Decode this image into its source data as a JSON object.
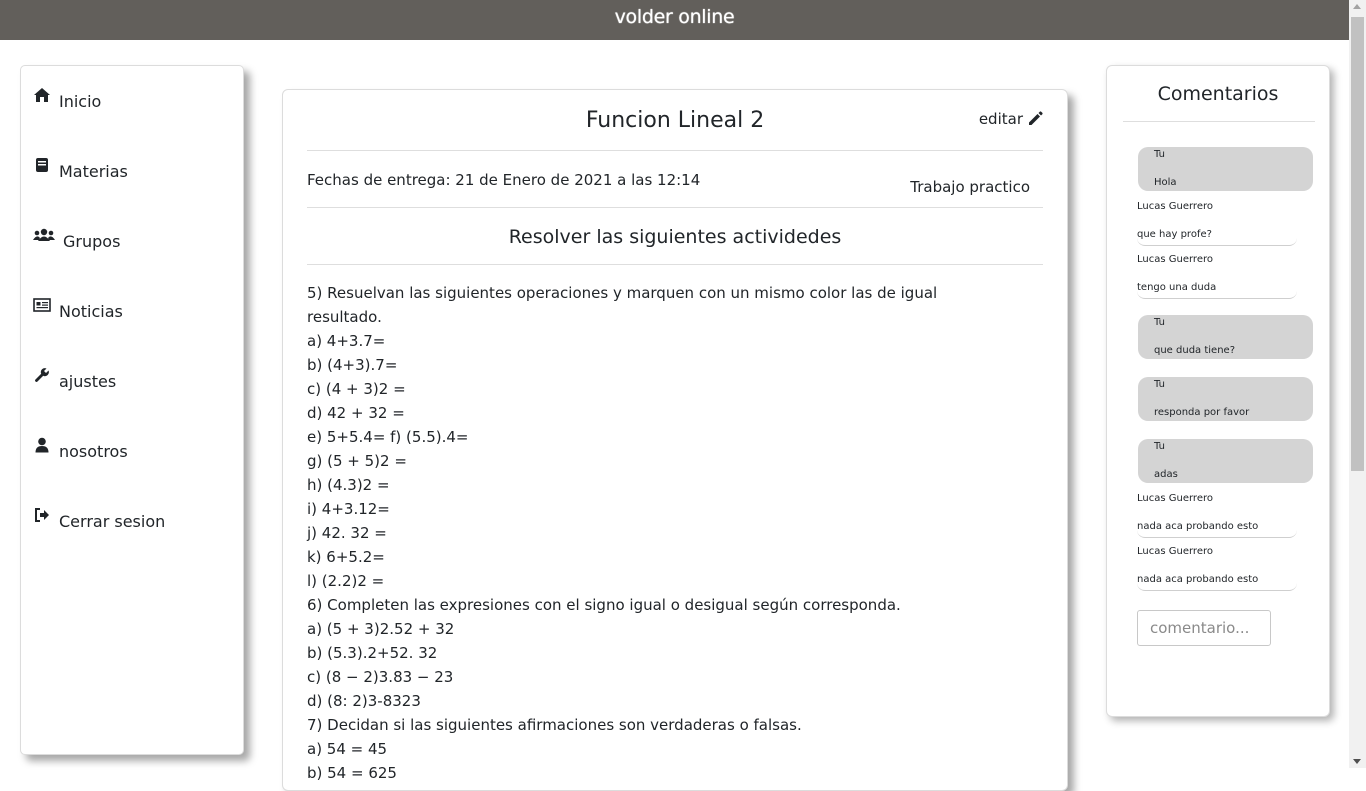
{
  "header": {
    "brand": "volder online"
  },
  "sidebar": {
    "items": [
      {
        "label": "Inicio",
        "icon": "home-icon"
      },
      {
        "label": "Materias",
        "icon": "book-icon"
      },
      {
        "label": "Grupos",
        "icon": "users-icon"
      },
      {
        "label": "Noticias",
        "icon": "newspaper-icon"
      },
      {
        "label": "ajustes",
        "icon": "wrench-icon"
      },
      {
        "label": "nosotros",
        "icon": "user-icon"
      },
      {
        "label": "Cerrar sesion",
        "icon": "sign-out-icon"
      }
    ]
  },
  "assignment": {
    "title": "Funcion Lineal 2",
    "edit_label": "editar",
    "dates": "Fechas de entrega: 21 de Enero de 2021 a las 12:14",
    "type": "Trabajo practico",
    "subtitle": "Resolver las siguientes actividedes",
    "lines": [
      "5) Resuelvan las siguientes operaciones y marquen con un mismo color las de igual",
      "resultado.",
      "a) 4+3.7=",
      "b) (4+3).7=",
      "c) (4 + 3)2 =",
      "d) 42 + 32 =",
      "e) 5+5.4= f) (5.5).4=",
      "g) (5 + 5)2 =",
      "h) (4.3)2 =",
      "i) 4+3.12=",
      "j) 42. 32 =",
      "k) 6+5.2=",
      "l) (2.2)2 =",
      "6) Completen las expresiones con el signo igual o desigual según corresponda.",
      "a) (5 + 3)2.52 + 32",
      "b) (5.3).2+52. 32",
      "c) (8 − 2)3.83 − 23",
      "d) (8: 2)3-8323",
      "7) Decidan si las siguientes afirmaciones son verdaderas o falsas.",
      "a) 54 = 45",
      "b) 54 = 625"
    ]
  },
  "comments": {
    "title": "Comentarios",
    "input_placeholder": "comentario...",
    "messages": [
      {
        "author": "Tu",
        "text": "Hola",
        "mine": true
      },
      {
        "author": "Lucas Guerrero",
        "text": "que hay profe?",
        "mine": false
      },
      {
        "author": "Lucas Guerrero",
        "text": "tengo una duda",
        "mine": false
      },
      {
        "author": "Tu",
        "text": "que duda tiene?",
        "mine": true
      },
      {
        "author": "Tu",
        "text": "responda por favor",
        "mine": true
      },
      {
        "author": "Tu",
        "text": "adas",
        "mine": true
      },
      {
        "author": "Lucas Guerrero",
        "text": "nada aca probando esto",
        "mine": false
      },
      {
        "author": "Lucas Guerrero",
        "text": "nada aca probando esto",
        "mine": false
      }
    ]
  },
  "colors": {
    "header_bg": "#625f5b",
    "bubble_bg": "#d4d4d4",
    "text": "#212529"
  }
}
